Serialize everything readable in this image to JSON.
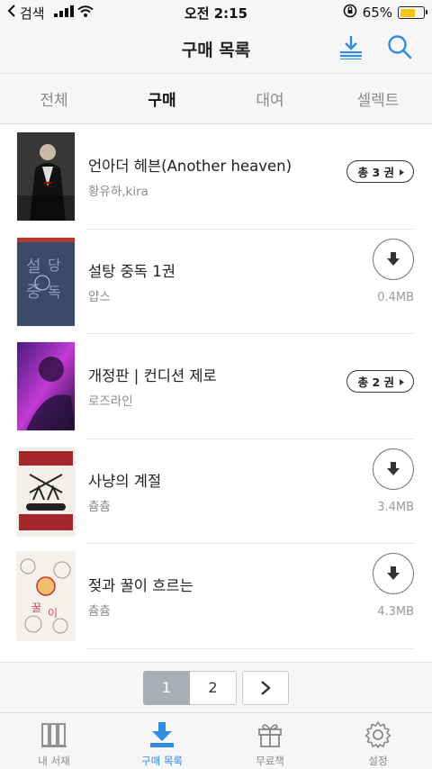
{
  "status_bar": {
    "back_label": "검색",
    "time": "오전 2:15",
    "battery": "65%"
  },
  "header": {
    "title": "구매 목록",
    "download_icon": "download-list-icon",
    "search_icon": "search-icon"
  },
  "tabs": [
    {
      "label": "전체"
    },
    {
      "label": "구매"
    },
    {
      "label": "대여"
    },
    {
      "label": "셀렉트"
    }
  ],
  "active_tab": "구매",
  "books": [
    {
      "title": "언아더 헤븐(Another heaven)",
      "author": "황유하,kira",
      "badge": "총 3 권"
    },
    {
      "title": "설탕 중독 1권",
      "author": "얍스",
      "size": "0.4MB"
    },
    {
      "title": "개정판 | 컨디션 제로",
      "author": "로즈라인",
      "badge": "총 2 권"
    },
    {
      "title": "사냥의 계절",
      "author": "츔츔",
      "size": "3.4MB"
    },
    {
      "title": "젖과 꿀이 흐르는",
      "author": "츔츔",
      "size": "4.3MB"
    }
  ],
  "pagination": {
    "pages": [
      "1",
      "2"
    ],
    "current": "1"
  },
  "tab_bar": [
    {
      "label": "내 서재",
      "icon": "bookshelf-icon"
    },
    {
      "label": "구매 목록",
      "icon": "download-tray-icon"
    },
    {
      "label": "무료책",
      "icon": "gift-icon"
    },
    {
      "label": "설정",
      "icon": "gear-icon"
    }
  ],
  "colors": {
    "accent": "#2f8ee0",
    "battery": "#f5c518",
    "pager_current": "#a9afb5"
  }
}
